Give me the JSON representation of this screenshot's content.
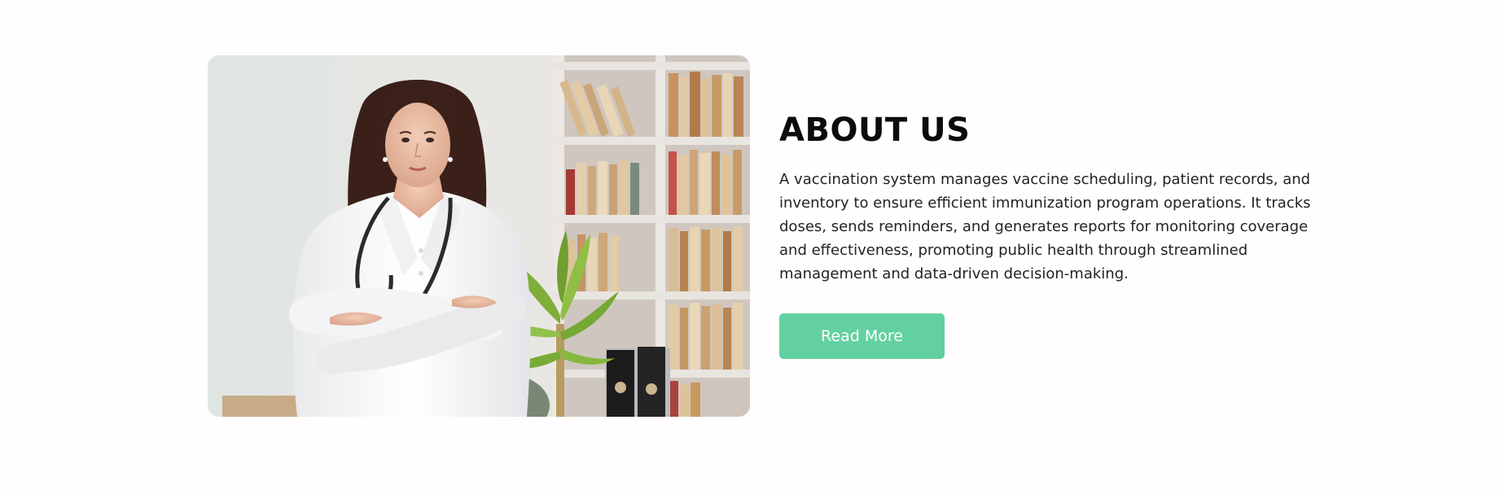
{
  "about": {
    "title": "ABOUT US",
    "description": "A vaccination system manages vaccine scheduling, patient records, and inventory to ensure efficient immunization program operations. It tracks doses, sends reminders, and generates reports for monitoring coverage and effectiveness, promoting public health through streamlined management and data-driven decision-making.",
    "button_label": "Read More"
  },
  "colors": {
    "page_background": "#fffdfd",
    "accent": "#63d0a2",
    "heading": "#0b0b0b",
    "body_text": "#232323"
  }
}
